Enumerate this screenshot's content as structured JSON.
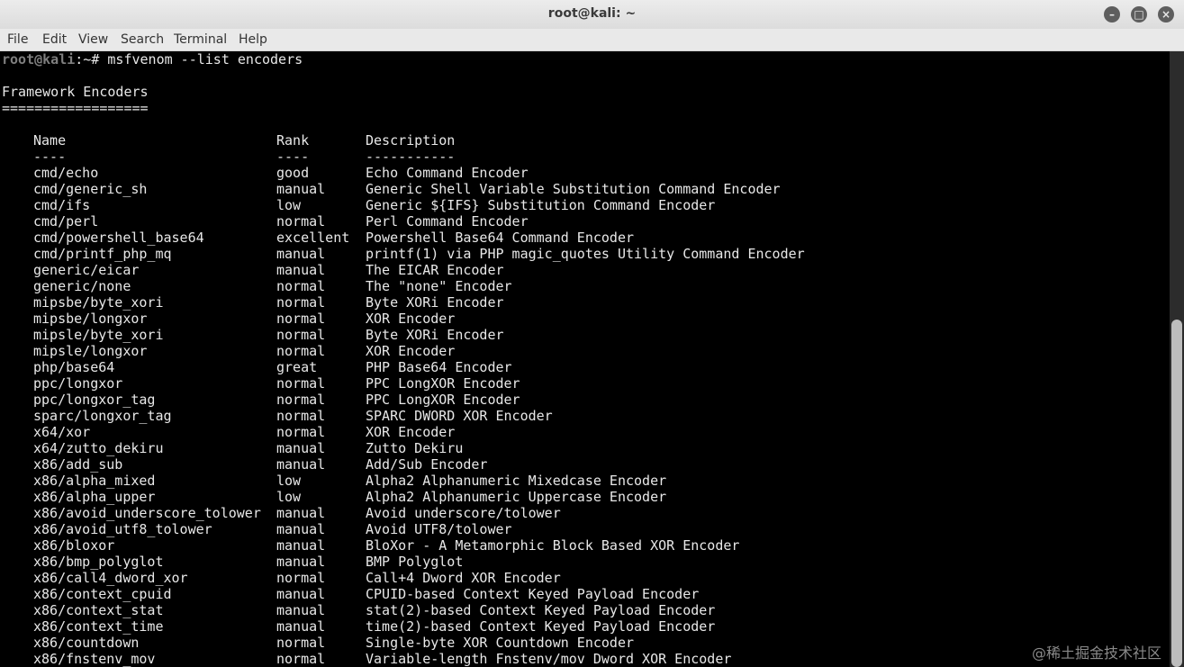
{
  "window": {
    "title": "root@kali: ~",
    "controls": [
      "minimize",
      "maximize",
      "close"
    ]
  },
  "menu": [
    "File",
    "Edit",
    "View",
    "Search",
    "Terminal",
    "Help"
  ],
  "prompt": {
    "user_host": "root@kali",
    "path_sign": ":~# ",
    "command": "msfvenom --list encoders"
  },
  "heading": "Framework Encoders",
  "underline": "==================",
  "headers": {
    "name": "Name",
    "rank": "Rank",
    "description": "Description"
  },
  "header_underlines": {
    "name": "----",
    "rank": "----",
    "description": "-----------"
  },
  "rows": [
    [
      "cmd/echo",
      "good",
      "Echo Command Encoder"
    ],
    [
      "cmd/generic_sh",
      "manual",
      "Generic Shell Variable Substitution Command Encoder"
    ],
    [
      "cmd/ifs",
      "low",
      "Generic ${IFS} Substitution Command Encoder"
    ],
    [
      "cmd/perl",
      "normal",
      "Perl Command Encoder"
    ],
    [
      "cmd/powershell_base64",
      "excellent",
      "Powershell Base64 Command Encoder"
    ],
    [
      "cmd/printf_php_mq",
      "manual",
      "printf(1) via PHP magic_quotes Utility Command Encoder"
    ],
    [
      "generic/eicar",
      "manual",
      "The EICAR Encoder"
    ],
    [
      "generic/none",
      "normal",
      "The \"none\" Encoder"
    ],
    [
      "mipsbe/byte_xori",
      "normal",
      "Byte XORi Encoder"
    ],
    [
      "mipsbe/longxor",
      "normal",
      "XOR Encoder"
    ],
    [
      "mipsle/byte_xori",
      "normal",
      "Byte XORi Encoder"
    ],
    [
      "mipsle/longxor",
      "normal",
      "XOR Encoder"
    ],
    [
      "php/base64",
      "great",
      "PHP Base64 Encoder"
    ],
    [
      "ppc/longxor",
      "normal",
      "PPC LongXOR Encoder"
    ],
    [
      "ppc/longxor_tag",
      "normal",
      "PPC LongXOR Encoder"
    ],
    [
      "sparc/longxor_tag",
      "normal",
      "SPARC DWORD XOR Encoder"
    ],
    [
      "x64/xor",
      "normal",
      "XOR Encoder"
    ],
    [
      "x64/zutto_dekiru",
      "manual",
      "Zutto Dekiru"
    ],
    [
      "x86/add_sub",
      "manual",
      "Add/Sub Encoder"
    ],
    [
      "x86/alpha_mixed",
      "low",
      "Alpha2 Alphanumeric Mixedcase Encoder"
    ],
    [
      "x86/alpha_upper",
      "low",
      "Alpha2 Alphanumeric Uppercase Encoder"
    ],
    [
      "x86/avoid_underscore_tolower",
      "manual",
      "Avoid underscore/tolower"
    ],
    [
      "x86/avoid_utf8_tolower",
      "manual",
      "Avoid UTF8/tolower"
    ],
    [
      "x86/bloxor",
      "manual",
      "BloXor - A Metamorphic Block Based XOR Encoder"
    ],
    [
      "x86/bmp_polyglot",
      "manual",
      "BMP Polyglot"
    ],
    [
      "x86/call4_dword_xor",
      "normal",
      "Call+4 Dword XOR Encoder"
    ],
    [
      "x86/context_cpuid",
      "manual",
      "CPUID-based Context Keyed Payload Encoder"
    ],
    [
      "x86/context_stat",
      "manual",
      "stat(2)-based Context Keyed Payload Encoder"
    ],
    [
      "x86/context_time",
      "manual",
      "time(2)-based Context Keyed Payload Encoder"
    ],
    [
      "x86/countdown",
      "normal",
      "Single-byte XOR Countdown Encoder"
    ],
    [
      "x86/fnstenv_mov",
      "normal",
      "Variable-length Fnstenv/mov Dword XOR Encoder"
    ]
  ],
  "watermark": "@稀土掘金技术社区",
  "colors": {
    "terminal_bg": "#000000",
    "terminal_fg": "#e8e8e8",
    "prompt_user": "#7f7f7f",
    "titlebar_bg": "#e4e4e4"
  }
}
